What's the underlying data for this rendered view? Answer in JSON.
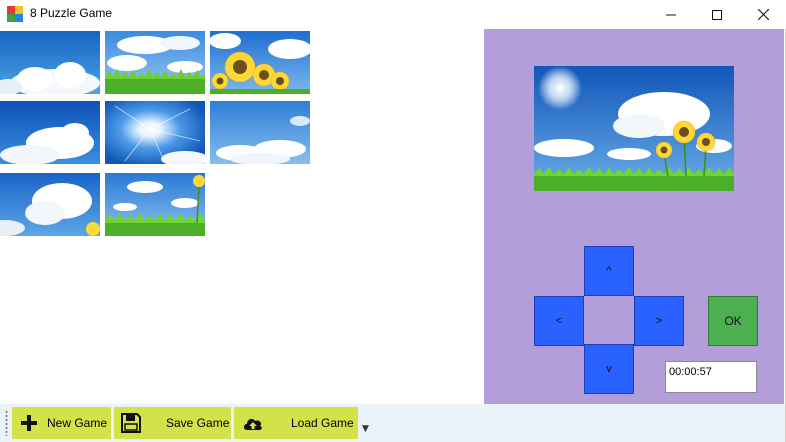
{
  "window": {
    "title": "8 Puzzle Game",
    "icon": "puzzle-app-icon"
  },
  "puzzle": {
    "tiles": [
      {
        "slot": 1,
        "piece": "sky-cloud-left"
      },
      {
        "slot": 2,
        "piece": "clouds-grass"
      },
      {
        "slot": 3,
        "piece": "sunflowers"
      },
      {
        "slot": 4,
        "piece": "cloud-mid-left"
      },
      {
        "slot": 5,
        "piece": "sun-burst"
      },
      {
        "slot": 6,
        "piece": "sky-clouds-right"
      },
      {
        "slot": 7,
        "piece": "cloud-bottom-left"
      },
      {
        "slot": 8,
        "piece": "grass-flower-edge"
      },
      {
        "slot": 9,
        "piece": "empty"
      }
    ]
  },
  "controls": {
    "up_label": "^",
    "left_label": "<",
    "right_label": ">",
    "down_label": "v",
    "ok_label": "OK",
    "timer_value": "00:00:57"
  },
  "toolbar": {
    "new_game_label": "New Game",
    "save_game_label": "Save Game",
    "load_game_label": "Load Game"
  },
  "colors": {
    "panel": "#b39ddb",
    "direction_button": "#2962ff",
    "ok_button": "#4caf50",
    "toolbar_button": "#d4e24a"
  }
}
